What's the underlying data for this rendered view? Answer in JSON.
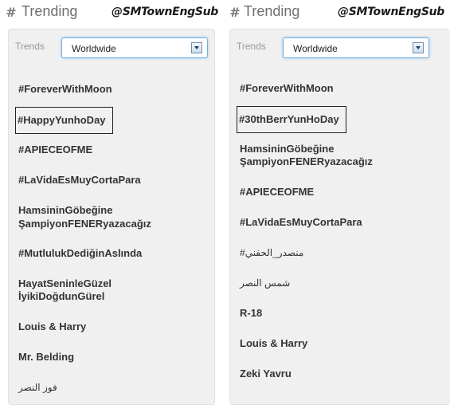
{
  "left": {
    "title": "Trending",
    "watermark": "@SMTownEngSub",
    "trends_label": "Trends",
    "location": "Worldwide",
    "items": [
      "#ForeverWithMoon",
      "#HappyYunhoDay",
      "#APIECEOFME",
      "#LaVidaEsMuyCortaPara",
      "HamsininGöbeğine",
      "ŞampiyonFENERyazacağız",
      "#MutlulukDediğinAslında",
      "HayatSeninleGüzel",
      "İyikiDoğdunGürel",
      "Louis & Harry",
      "Mr. Belding",
      "فوز النصر"
    ]
  },
  "right": {
    "title": "Trending",
    "watermark": "@SMTownEngSub",
    "trends_label": "Trends",
    "location": "Worldwide",
    "items": [
      "#ForeverWithMoon",
      "#30thBerrYunHoDay",
      "HamsininGöbeğine",
      "ŞampiyonFENERyazacağız",
      "#APIECEOFME",
      "#LaVidaEsMuyCortaPara",
      "#منصدر_الحفني",
      "شمس النصر",
      "R-18",
      "Louis & Harry",
      "Zeki Yavru"
    ]
  }
}
